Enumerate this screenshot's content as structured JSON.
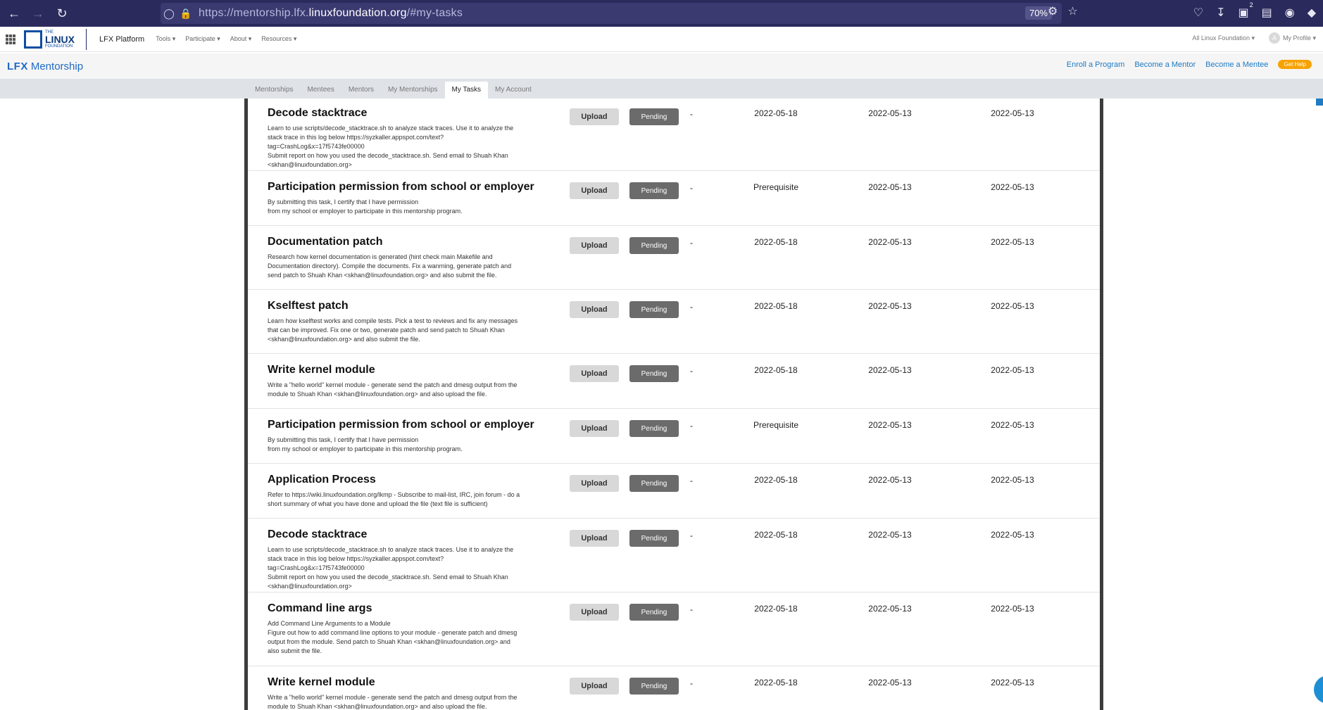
{
  "browser": {
    "url_prefix": "https://mentorship.lfx.",
    "url_host": "linuxfoundation.org",
    "url_suffix": "/#my-tasks",
    "zoom": "70%",
    "downloads_badge": "2"
  },
  "lf_nav": {
    "logo_the": "THE",
    "logo_linux": "LINUX",
    "logo_foundation": "FOUNDATION",
    "platform": "LFX Platform",
    "menu": [
      "Tools ▾",
      "Participate ▾",
      "About ▾",
      "Resources ▾"
    ],
    "org_select": "All Linux Foundation ▾",
    "avatar_letter": "A",
    "profile": "My Profile ▾"
  },
  "mentorship_header": {
    "logo_lfx": "LFX",
    "logo_name": "Mentorship",
    "links": [
      "Enroll a Program",
      "Become a Mentor",
      "Become a Mentee"
    ],
    "help": "Get Help"
  },
  "tabs": [
    "Mentorships",
    "Mentees",
    "Mentors",
    "My Mentorships",
    "My Tasks",
    "My Account"
  ],
  "active_tab": "My Tasks",
  "tasks": [
    {
      "title": "Decode stacktrace",
      "desc": "Learn to use scripts/decode_stacktrace.sh to analyze stack traces. Use it to analyze the stack trace in this log below https://syzkaller.appspot.com/text?tag=CrashLog&x=17f5743fe00000\nSubmit report on how you used the decode_stacktrace.sh. Send email to Shuah Khan <skhan@linuxfoundation.org>",
      "upload": "Upload",
      "status": "Pending",
      "note": "-",
      "due": "2022-05-18",
      "created": "2022-05-13",
      "updated": "2022-05-13"
    },
    {
      "title": "Participation permission from school or employer",
      "desc": "By submitting this task, I certify that I have permission\nfrom my school or employer to participate in this mentorship program.",
      "upload": "Upload",
      "status": "Pending",
      "note": "-",
      "due": "Prerequisite",
      "created": "2022-05-13",
      "updated": "2022-05-13"
    },
    {
      "title": "Documentation patch",
      "desc": "Research how kernel documentation is generated (hint check main Makefile and Documentation directory). Compile the documents. Fix a wanrning, generate patch and send patch to Shuah Khan <skhan@linuxfoundation.org> and also submit the file.",
      "upload": "Upload",
      "status": "Pending",
      "note": "-",
      "due": "2022-05-18",
      "created": "2022-05-13",
      "updated": "2022-05-13"
    },
    {
      "title": "Kselftest patch",
      "desc": "Learn how kselftest works and compile tests. Pick a test to reviews and fix any messages that can be improved. Fix one or two, generate patch and send patch to Shuah Khan <skhan@linuxfoundation.org> and also submit the file.",
      "upload": "Upload",
      "status": "Pending",
      "note": "-",
      "due": "2022-05-18",
      "created": "2022-05-13",
      "updated": "2022-05-13"
    },
    {
      "title": "Write kernel module",
      "desc": "Write a \"hello world\" kernel module - generate send the patch and dmesg output from the module to Shuah Khan <skhan@linuxfoundation.org> and also upload the file.",
      "upload": "Upload",
      "status": "Pending",
      "note": "-",
      "due": "2022-05-18",
      "created": "2022-05-13",
      "updated": "2022-05-13"
    },
    {
      "title": "Participation permission from school or employer",
      "desc": "By submitting this task, I certify that I have permission\nfrom my school or employer to participate in this mentorship program.",
      "upload": "Upload",
      "status": "Pending",
      "note": "-",
      "due": "Prerequisite",
      "created": "2022-05-13",
      "updated": "2022-05-13"
    },
    {
      "title": "Application Process",
      "desc": "Refer to https://wiki.linuxfoundation.org/lkmp - Subscribe to mail-list, IRC, join forum - do a short summary of what you have done and upload the file (text file is sufficient)",
      "upload": "Upload",
      "status": "Pending",
      "note": "-",
      "due": "2022-05-18",
      "created": "2022-05-13",
      "updated": "2022-05-13"
    },
    {
      "title": "Decode stacktrace",
      "desc": "Learn to use scripts/decode_stacktrace.sh to analyze stack traces. Use it to analyze the stack trace in this log below https://syzkaller.appspot.com/text?tag=CrashLog&x=17f5743fe00000\nSubmit report on how you used the decode_stacktrace.sh. Send email to Shuah Khan <skhan@linuxfoundation.org>",
      "upload": "Upload",
      "status": "Pending",
      "note": "-",
      "due": "2022-05-18",
      "created": "2022-05-13",
      "updated": "2022-05-13"
    },
    {
      "title": "Command line args",
      "desc": "Add Command Line Arguments to a Module\nFigure out how to add command line options to your module - generate patch and dmesg output from the module. Send patch to Shuah Khan <skhan@linuxfoundation.org> and also submit the file.",
      "upload": "Upload",
      "status": "Pending",
      "note": "-",
      "due": "2022-05-18",
      "created": "2022-05-13",
      "updated": "2022-05-13"
    },
    {
      "title": "Write kernel module",
      "desc": "Write a \"hello world\" kernel module - generate send the patch and dmesg output from the module to Shuah Khan <skhan@linuxfoundation.org> and also upload the file.",
      "upload": "Upload",
      "status": "Pending",
      "note": "-",
      "due": "2022-05-18",
      "created": "2022-05-13",
      "updated": "2022-05-13"
    }
  ]
}
